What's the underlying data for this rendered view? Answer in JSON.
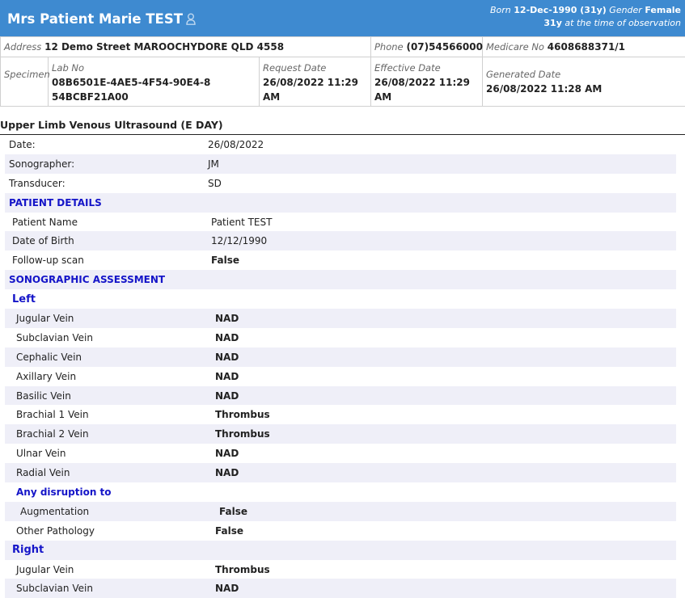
{
  "patient": {
    "name": "Mrs Patient Marie TEST",
    "born_label": "Born",
    "born_value": "12-Dec-1990 (31y)",
    "gender_label": "Gender",
    "gender_value": "Female",
    "age_value": "31y",
    "age_note": "at the time of observation"
  },
  "info": {
    "address_label": "Address",
    "address_value": "12 Demo Street MAROOCHYDORE QLD 4558",
    "phone_label": "Phone",
    "phone_value": "(07)54566000",
    "medicare_label": "Medicare No",
    "medicare_value": "4608688371/1",
    "specimen_label": "Specimen",
    "labno_label": "Lab No",
    "labno_value": "08B6501E-4AE5-4F54-90E4-854BCBF21A00",
    "request_label": "Request Date",
    "request_value": "26/08/2022 11:29 AM",
    "effective_label": "Effective Date",
    "effective_value": "26/08/2022 11:29 AM",
    "generated_label": "Generated Date",
    "generated_value": "26/08/2022 11:28 AM"
  },
  "report": {
    "title": "Upper Limb Venous Ultrasound (E DAY)",
    "rows": [
      {
        "k": "Date:",
        "v": "26/08/2022",
        "type": "field",
        "indent": 0
      },
      {
        "k": "Sonographer:",
        "v": "JM",
        "type": "field",
        "indent": 0
      },
      {
        "k": "Transducer:",
        "v": "SD",
        "type": "field",
        "indent": 0
      },
      {
        "k": "PATIENT DETAILS",
        "v": "",
        "type": "section",
        "indent": 0
      },
      {
        "k": "Patient Name",
        "v": "Patient TEST",
        "type": "field",
        "indent": 1
      },
      {
        "k": "Date of Birth",
        "v": "12/12/1990",
        "type": "field",
        "indent": 1
      },
      {
        "k": "Follow-up scan",
        "v": "False",
        "type": "bold",
        "indent": 1
      },
      {
        "k": "SONOGRAPHIC ASSESSMENT",
        "v": "",
        "type": "section",
        "indent": 0
      },
      {
        "k": "Left",
        "v": "",
        "type": "section-big",
        "indent": 1
      },
      {
        "k": "Jugular Vein",
        "v": "NAD",
        "type": "bold",
        "indent": 2
      },
      {
        "k": "Subclavian Vein",
        "v": "NAD",
        "type": "bold",
        "indent": 2
      },
      {
        "k": "Cephalic Vein",
        "v": "NAD",
        "type": "bold",
        "indent": 2
      },
      {
        "k": "Axillary Vein",
        "v": "NAD",
        "type": "bold",
        "indent": 2
      },
      {
        "k": "Basilic Vein",
        "v": "NAD",
        "type": "bold",
        "indent": 2
      },
      {
        "k": "Brachial 1 Vein",
        "v": "Thrombus",
        "type": "bold",
        "indent": 2
      },
      {
        "k": "Brachial 2 Vein",
        "v": "Thrombus",
        "type": "bold",
        "indent": 2
      },
      {
        "k": "Ulnar Vein",
        "v": "NAD",
        "type": "bold",
        "indent": 2
      },
      {
        "k": "Radial Vein",
        "v": "NAD",
        "type": "bold",
        "indent": 2
      },
      {
        "k": "Any disruption to",
        "v": "",
        "type": "section",
        "indent": 2
      },
      {
        "k": "Augmentation",
        "v": "False",
        "type": "bold",
        "indent": 3
      },
      {
        "k": "Other Pathology",
        "v": "False",
        "type": "bold",
        "indent": 2
      },
      {
        "k": "Right",
        "v": "",
        "type": "section-big",
        "indent": 1
      },
      {
        "k": "Jugular Vein",
        "v": "Thrombus",
        "type": "bold",
        "indent": 2
      },
      {
        "k": "Subclavian Vein",
        "v": "NAD",
        "type": "bold",
        "indent": 2
      }
    ]
  },
  "icons": {
    "person": "person-icon"
  },
  "colors": {
    "banner": "#3e8ad0",
    "section": "#1515c8",
    "stripe": "#efeff8"
  }
}
